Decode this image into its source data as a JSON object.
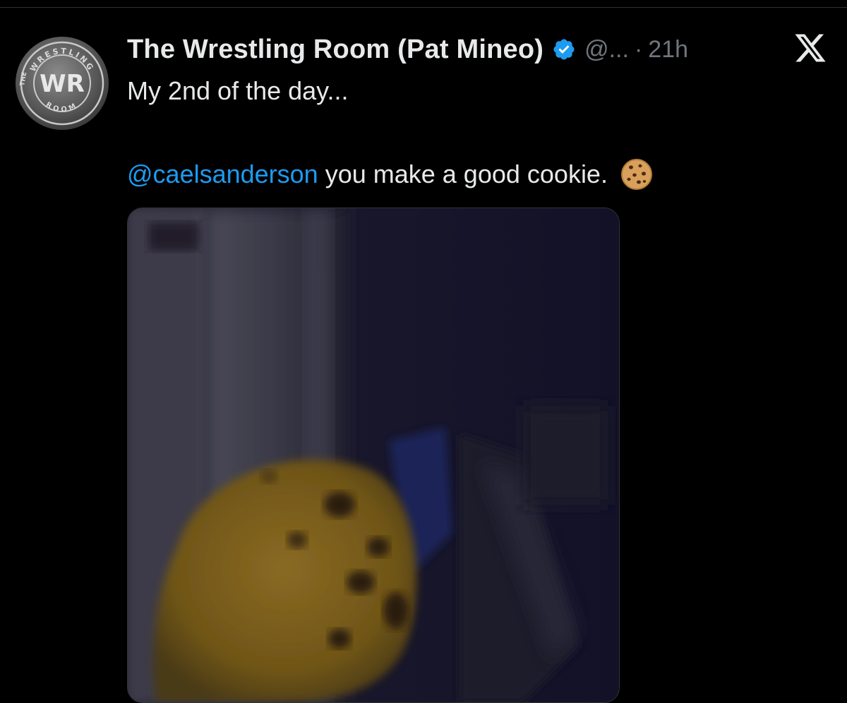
{
  "tweet": {
    "display_name": "The Wrestling Room (Pat Mineo)",
    "handle": "@...",
    "separator": "·",
    "time": "21h",
    "text_line1": "My 2nd of the day...",
    "mention": "@caelsanderson",
    "text_line2_rest": " you make a good cookie.",
    "verified_icon": "verified-badge-icon",
    "emoji_icon": "cookie-icon"
  },
  "avatar": {
    "logo_letters": "WR",
    "ring_top": "WRESTLING",
    "ring_left": "THE",
    "ring_bottom": "ROOM"
  },
  "colors": {
    "background": "#000000",
    "text": "#e7e9ea",
    "secondary_text": "#71767b",
    "link": "#1d9bf0",
    "verified": "#1d9bf0"
  },
  "icons": {
    "top_right": "x-logo-icon"
  }
}
